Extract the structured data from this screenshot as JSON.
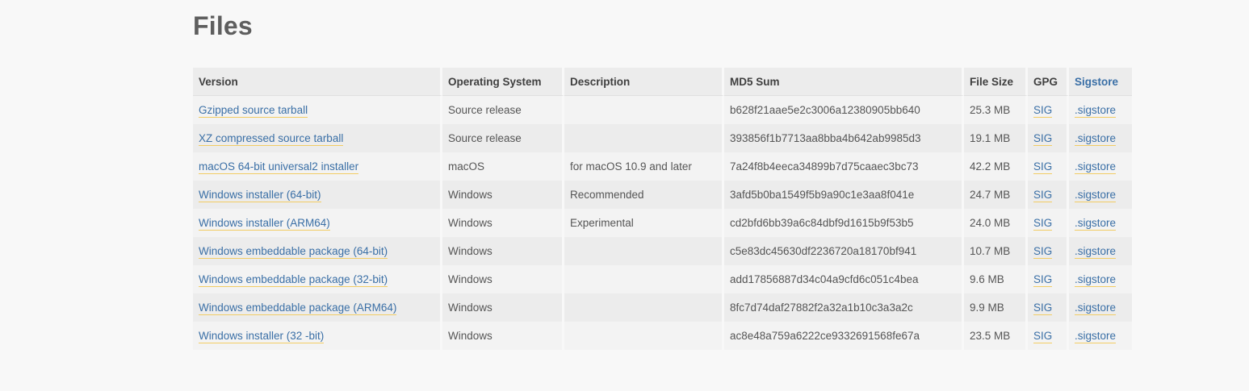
{
  "page": {
    "title": "Files"
  },
  "table": {
    "headers": {
      "version": "Version",
      "os": "Operating System",
      "description": "Description",
      "md5": "MD5 Sum",
      "size": "File Size",
      "gpg": "GPG",
      "sigstore": "Sigstore"
    },
    "rows": [
      {
        "version": "Gzipped source tarball",
        "os": "Source release",
        "description": "",
        "md5": "b628f21aae5e2c3006a12380905bb640",
        "size": "25.3 MB",
        "gpg": "SIG",
        "sigstore": ".sigstore"
      },
      {
        "version": "XZ compressed source tarball",
        "os": "Source release",
        "description": "",
        "md5": "393856f1b7713aa8bba4b642ab9985d3",
        "size": "19.1 MB",
        "gpg": "SIG",
        "sigstore": ".sigstore"
      },
      {
        "version": "macOS 64-bit universal2 installer",
        "os": "macOS",
        "description": "for macOS 10.9 and later",
        "md5": "7a24f8b4eeca34899b7d75caaec3bc73",
        "size": "42.2 MB",
        "gpg": "SIG",
        "sigstore": ".sigstore"
      },
      {
        "version": "Windows installer (64-bit)",
        "os": "Windows",
        "description": "Recommended",
        "md5": "3afd5b0ba1549f5b9a90c1e3aa8f041e",
        "size": "24.7 MB",
        "gpg": "SIG",
        "sigstore": ".sigstore"
      },
      {
        "version": "Windows installer (ARM64)",
        "os": "Windows",
        "description": "Experimental",
        "md5": "cd2bfd6bb39a6c84dbf9d1615b9f53b5",
        "size": "24.0 MB",
        "gpg": "SIG",
        "sigstore": ".sigstore"
      },
      {
        "version": "Windows embeddable package (64-bit)",
        "os": "Windows",
        "description": "",
        "md5": "c5e83dc45630df2236720a18170bf941",
        "size": "10.7 MB",
        "gpg": "SIG",
        "sigstore": ".sigstore"
      },
      {
        "version": "Windows embeddable package (32-bit)",
        "os": "Windows",
        "description": "",
        "md5": "add17856887d34c04a9cfd6c051c4bea",
        "size": "9.6 MB",
        "gpg": "SIG",
        "sigstore": ".sigstore"
      },
      {
        "version": "Windows embeddable package (ARM64)",
        "os": "Windows",
        "description": "",
        "md5": "8fc7d74daf27882f2a32a1b10c3a3a2c",
        "size": "9.9 MB",
        "gpg": "SIG",
        "sigstore": ".sigstore"
      },
      {
        "version": "Windows installer (32 -bit)",
        "os": "Windows",
        "description": "",
        "md5": "ac8e48a759a6222ce9332691568fe67a",
        "size": "23.5 MB",
        "gpg": "SIG",
        "sigstore": ".sigstore"
      }
    ]
  },
  "colors": {
    "background": "#f8f8f8",
    "link": "#3a6fa6",
    "link_underline": "#f2cc64",
    "header_bg": "#ececec"
  }
}
